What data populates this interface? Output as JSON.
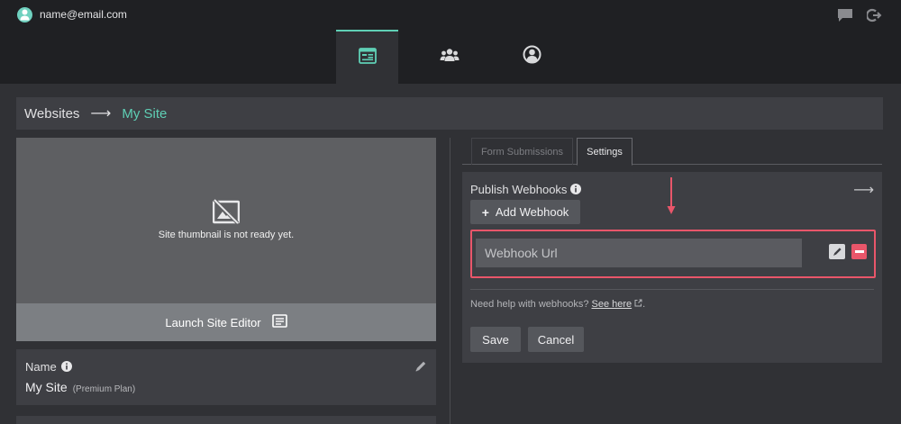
{
  "header": {
    "user_email": "name@email.com",
    "icons": [
      "user-avatar-icon",
      "chat-icon",
      "logout-icon"
    ]
  },
  "nav": {
    "tabs": [
      {
        "icon": "website-icon",
        "active": true
      },
      {
        "icon": "users-icon",
        "active": false
      },
      {
        "icon": "account-icon",
        "active": false
      }
    ]
  },
  "breadcrumb": {
    "root": "Websites",
    "separator": "⟶",
    "current": "My Site"
  },
  "site": {
    "thumbnail_message": "Site thumbnail is not ready yet.",
    "launch_label": "Launch Site Editor",
    "name_label": "Name",
    "name_value": "My Site",
    "plan": "(Premium Plan)"
  },
  "tabs": {
    "form_submissions": "Form Submissions",
    "settings": "Settings",
    "active": "Settings"
  },
  "webhooks": {
    "label": "Publish Webhooks",
    "add_label": "Add Webhook",
    "url_placeholder": "Webhook Url",
    "url_value": "",
    "help_text": "Need help with webhooks?",
    "help_link": "See here",
    "help_suffix": "."
  },
  "actions": {
    "save": "Save",
    "cancel": "Cancel"
  },
  "colors": {
    "accent": "#5fcfb5",
    "highlight": "#e9566a",
    "background": "#303135",
    "panel": "#3e3f44",
    "topbar": "#1f2023"
  }
}
